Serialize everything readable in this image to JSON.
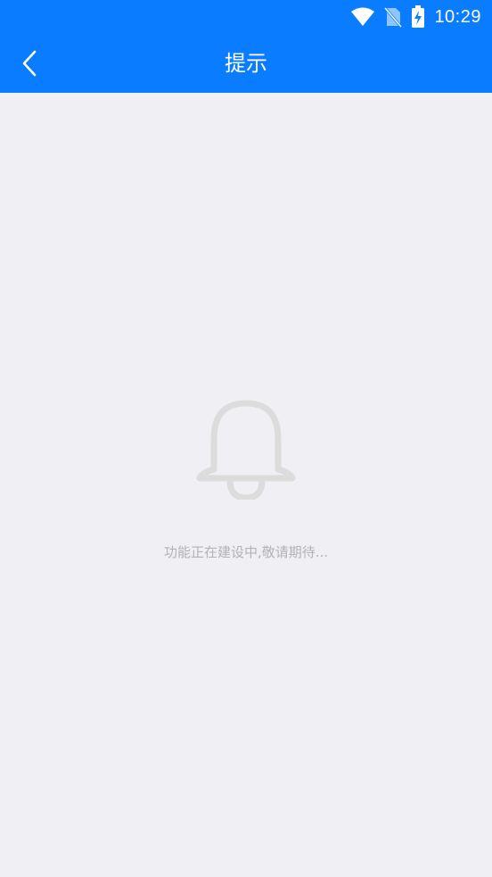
{
  "status_bar": {
    "time": "10:29",
    "icons": [
      "wifi-icon",
      "no-sim-icon",
      "battery-charging-icon"
    ]
  },
  "nav": {
    "title": "提示",
    "back_icon": "chevron-left-icon"
  },
  "empty_state": {
    "icon": "bell-icon",
    "message": "功能正在建设中,敬请期待..."
  },
  "colors": {
    "primary": "#0a7cff",
    "background": "#efeff4",
    "icon_gray": "#dcdcdc",
    "text_gray": "#b3b3b3"
  }
}
